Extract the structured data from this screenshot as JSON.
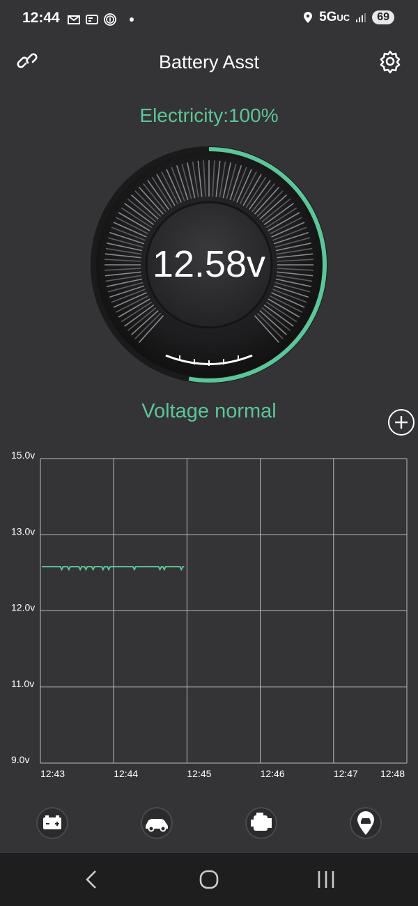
{
  "status_bar": {
    "time": "12:44",
    "network": "5G",
    "network_suffix": "UC",
    "battery_level": "69"
  },
  "header": {
    "title": "Battery Asst"
  },
  "electricity_text": "Electricity:100%",
  "gauge": {
    "value_text": "12.58v",
    "fill_fraction": 1.0,
    "accent_color": "#5cc59a"
  },
  "voltage_status": "Voltage normal",
  "chart_data": {
    "type": "line",
    "y_tick_labels": [
      "15.0v",
      "13.0v",
      "12.0v",
      "11.0v",
      "9.0v"
    ],
    "x_tick_labels": [
      "12:43",
      "12:44",
      "12:45",
      "12:46",
      "12:47",
      "12:48"
    ],
    "series": [
      {
        "color": "#5cc59a",
        "x": [
          "12:43",
          "12:44",
          "12:45"
        ],
        "y": [
          12.58,
          12.58,
          12.58
        ]
      }
    ],
    "grid": true
  },
  "tabs": [
    {
      "icon": "battery-icon"
    },
    {
      "icon": "car-icon"
    },
    {
      "icon": "engine-icon"
    },
    {
      "icon": "car-location-icon"
    }
  ],
  "nav": {
    "back": "back-icon",
    "home": "home-icon",
    "recents": "recents-icon"
  }
}
